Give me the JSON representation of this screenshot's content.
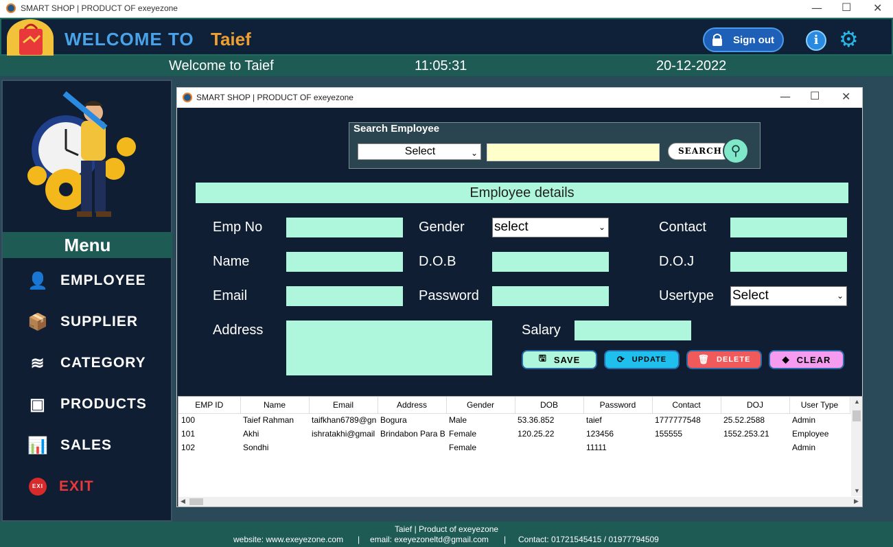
{
  "window": {
    "title": "SMART SHOP | PRODUCT OF exeyezone",
    "minimize": "—",
    "maximize": "☐",
    "close": "✕"
  },
  "header": {
    "welcome": "WELCOME TO",
    "username": "Taief",
    "signout_label": "Sign out",
    "info_glyph": "i",
    "gear_glyph": "⚙"
  },
  "statusbar": {
    "welcome_text": "Welcome to Taief",
    "time": "11:05:31",
    "date": "20-12-2022"
  },
  "sidebar": {
    "menu_title": "Menu",
    "items": [
      {
        "label": "EMPLOYEE",
        "icon": "employee-icon",
        "glyph": "👤"
      },
      {
        "label": "SUPPLIER",
        "icon": "supplier-icon",
        "glyph": "📦"
      },
      {
        "label": "CATEGORY",
        "icon": "category-icon",
        "glyph": "≋"
      },
      {
        "label": "PRODUCTS",
        "icon": "products-icon",
        "glyph": "▣"
      },
      {
        "label": "SALES",
        "icon": "sales-icon",
        "glyph": "📊"
      },
      {
        "label": "EXIT",
        "icon": "exit-icon",
        "glyph": "EXI"
      }
    ],
    "exit_color": "#e8383a"
  },
  "inner_window": {
    "title": "SMART SHOP | PRODUCT OF exeyezone",
    "minimize": "—",
    "maximize": "☐",
    "close": "✕"
  },
  "search": {
    "legend": "Search Employee",
    "select_value": "Select",
    "input_value": "",
    "button_label": "SEARCH",
    "icon_glyph": "⚲"
  },
  "details": {
    "header": "Employee details",
    "labels": {
      "emp_no": "Emp No",
      "gender": "Gender",
      "contact": "Contact",
      "name": "Name",
      "dob": "D.O.B",
      "doj": "D.O.J",
      "email": "Email",
      "password": "Password",
      "usertype": "Usertype",
      "address": "Address",
      "salary": "Salary"
    },
    "gender_value": "select",
    "usertype_value": "Select",
    "chevron": "⌄"
  },
  "actions": {
    "save": "SAVE",
    "update": "UPDATE",
    "delete": "DELETE",
    "clear": "CLEAR",
    "save_glyph": "🖫",
    "update_glyph": "⟳",
    "delete_glyph": "🗑",
    "clear_glyph": "◆",
    "colors": {
      "save": "#aef7dc",
      "update": "#1fc0ee",
      "delete": "#f05a5a",
      "clear": "#f59cf0"
    }
  },
  "table": {
    "columns": [
      "EMP ID",
      "Name",
      "Email",
      "Address",
      "Gender",
      "DOB",
      "Password",
      "Contact",
      "DOJ",
      "User Type"
    ],
    "rows": [
      [
        "100",
        "Taief Rahman",
        "taifkhan6789@gn",
        "Bogura",
        "Male",
        "53.36.852",
        "taief",
        "1777777548",
        "25.52.2588",
        "Admin"
      ],
      [
        "101",
        "Akhi",
        "ishratakhi@gmail",
        "Brindabon Para B",
        "Female",
        "120.25.22",
        "123456",
        "155555",
        "1552.253.21",
        "Employee"
      ],
      [
        "102",
        "Sondhi",
        "",
        "",
        "Female",
        "",
        "11111",
        "",
        "",
        "Admin"
      ]
    ]
  },
  "footer": {
    "line1": "Taief | Product of exeyezone",
    "website": "website: www.exeyezone.com",
    "email": "email: exeyezoneltd@gmail.com",
    "contact": "Contact: 01721545415 / 01977794509",
    "sep": "|"
  }
}
